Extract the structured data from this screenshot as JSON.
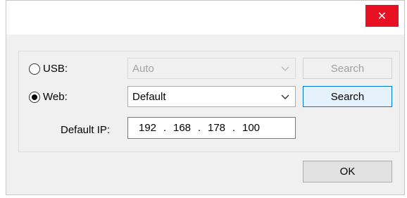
{
  "window": {
    "close_glyph": "✕",
    "close_color": "#e81123"
  },
  "usb": {
    "label": "USB:",
    "selected": false,
    "select_value": "Auto",
    "search_label": "Search",
    "disabled": true
  },
  "web": {
    "label": "Web:",
    "selected": true,
    "select_value": "Default",
    "search_label": "Search"
  },
  "ip": {
    "label": "Default IP:",
    "octets": [
      "192",
      "168",
      "178",
      "100"
    ],
    "separator": "."
  },
  "footer": {
    "ok_label": "OK"
  },
  "colors": {
    "accent_focus": "#0078d7"
  },
  "icons": {
    "dropdown": "chevron-down-icon",
    "close": "close-icon"
  }
}
